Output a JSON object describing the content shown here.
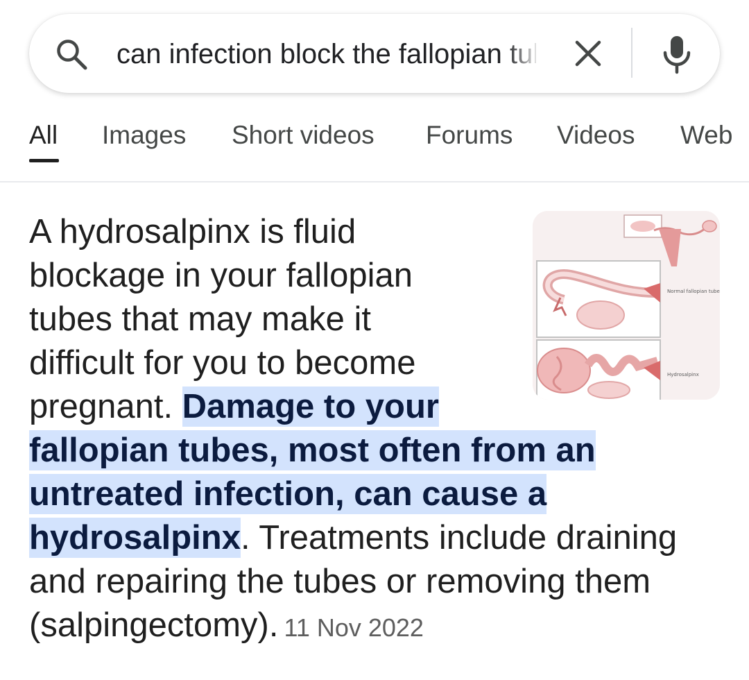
{
  "search": {
    "query": "can infection block the fallopian tubes",
    "icons": {
      "search": "search-icon",
      "clear": "close-icon",
      "voice": "microphone-icon"
    }
  },
  "tabs": [
    {
      "label": "All",
      "active": true
    },
    {
      "label": "Images",
      "active": false
    },
    {
      "label": "Short videos",
      "active": false
    },
    {
      "label": "Forums",
      "active": false
    },
    {
      "label": "Videos",
      "active": false
    },
    {
      "label": "Web",
      "active": false
    }
  ],
  "answer": {
    "text_before": "A hydrosalpinx is fluid blockage in your fallopian tubes that may make it difficult for you to become pregnant. ",
    "highlighted": "Damage to your fallopian tubes, most often from an untreated infection, can cause a hydrosalpinx",
    "text_after": ". Treatments include draining and repairing the tubes or removing them (salpingectomy).",
    "date": "11 Nov 2022"
  },
  "thumbnail": {
    "label_top": "Normal fallopian tube",
    "label_bottom": "Hydrosalpinx"
  },
  "colors": {
    "highlight_background": "#d3e3fd",
    "highlight_text": "#0b1b3f",
    "text_primary": "#1f1f1f",
    "text_secondary": "#444746",
    "date_text": "#5e5e5e"
  }
}
